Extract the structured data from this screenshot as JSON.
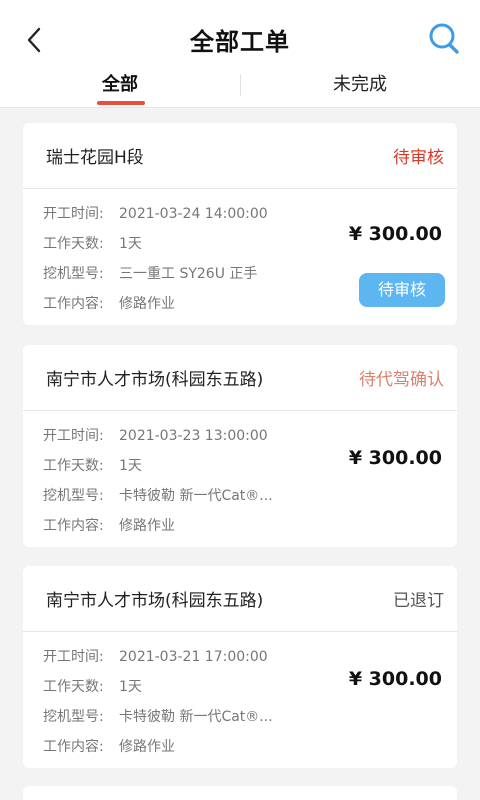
{
  "header": {
    "title": "全部工单"
  },
  "tabs": [
    {
      "label": "全部",
      "active": true
    },
    {
      "label": "未完成",
      "active": false
    }
  ],
  "labels": {
    "start_time": "开工时间:",
    "days": "工作天数:",
    "model": "挖机型号:",
    "content": "工作内容:"
  },
  "orders": [
    {
      "name": "瑞士花园H段",
      "status": "待审核",
      "status_color": "#d83a2a",
      "start_time": "2021-03-24 14:00:00",
      "days": "1天",
      "model": "三一重工 SY26U 正手",
      "content": "修路作业",
      "price": "¥ 300.00",
      "button": "待审核"
    },
    {
      "name": "南宁市人才市场(科园东五路)",
      "status": "待代驾确认",
      "status_color": "#e0806a",
      "start_time": "2021-03-23 13:00:00",
      "days": "1天",
      "model": "卡特彼勒 新一代Cat®...",
      "content": "修路作业",
      "price": "¥ 300.00"
    },
    {
      "name": "南宁市人才市场(科园东五路)",
      "status": "已退订",
      "status_color": "#555555",
      "start_time": "2021-03-21 17:00:00",
      "days": "1天",
      "model": "卡特彼勒 新一代Cat®...",
      "content": "修路作业",
      "price": "¥ 300.00"
    }
  ]
}
